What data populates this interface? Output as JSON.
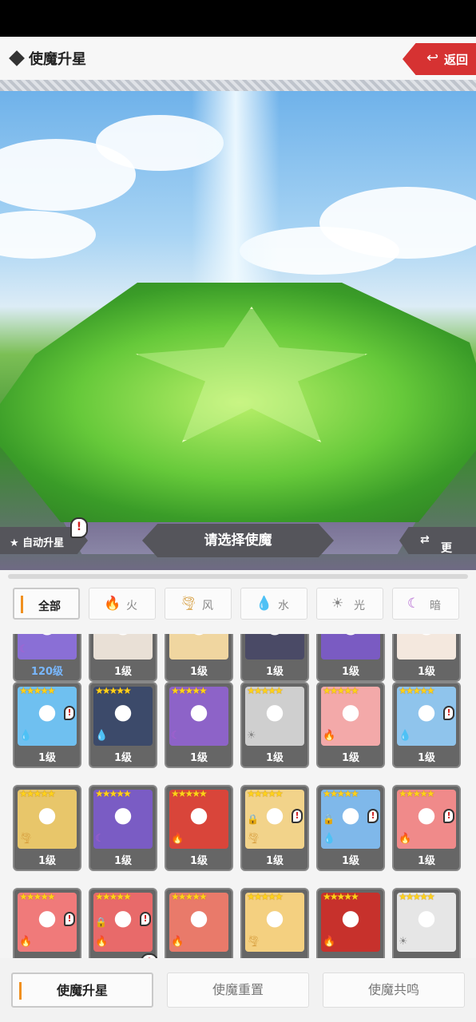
{
  "header": {
    "title": "使魔升星",
    "back_label": "返回",
    "back_icon": "return-arrow"
  },
  "stage": {
    "auto_star_label": "★ 自动升星",
    "select_label": "请选择使魔",
    "swap_label": "更换",
    "swap_icon": "swap-arrows"
  },
  "filters": [
    {
      "label": "全部",
      "icon": "",
      "active": true
    },
    {
      "label": "火",
      "icon": "fire",
      "active": false
    },
    {
      "label": "风",
      "icon": "wind",
      "active": false
    },
    {
      "label": "水",
      "icon": "water",
      "active": false
    },
    {
      "label": "光",
      "icon": "light",
      "active": false
    },
    {
      "label": "暗",
      "icon": "dark",
      "active": false
    }
  ],
  "cards": [
    {
      "level": "120级",
      "stars": "",
      "element": "dark",
      "color": "#8a6fd6",
      "locked": false,
      "alert": false,
      "highlight": true
    },
    {
      "level": "1级",
      "stars": "",
      "element": "",
      "color": "#e9e0d6",
      "locked": false,
      "alert": false
    },
    {
      "level": "1级",
      "stars": "",
      "element": "",
      "color": "#f0d6a0",
      "locked": false,
      "alert": false
    },
    {
      "level": "1级",
      "stars": "",
      "element": "",
      "color": "#4a4a66",
      "locked": false,
      "alert": false
    },
    {
      "level": "1级",
      "stars": "",
      "element": "",
      "color": "#7a5bc2",
      "locked": false,
      "alert": false
    },
    {
      "level": "1级",
      "stars": "",
      "element": "",
      "color": "#f4e8de",
      "locked": false,
      "alert": false
    },
    {
      "level": "1级",
      "stars": "★★★★★",
      "element": "water",
      "color": "#6fc0f0",
      "locked": false,
      "alert": true
    },
    {
      "level": "1级",
      "stars": "★★★★★",
      "element": "water",
      "color": "#3c4a6a",
      "locked": false,
      "alert": false
    },
    {
      "level": "1级",
      "stars": "★★★★★",
      "element": "dark",
      "color": "#8d63c8",
      "locked": false,
      "alert": false
    },
    {
      "level": "1级",
      "stars": "★★★★★",
      "element": "light",
      "color": "#cfcfcf",
      "locked": false,
      "alert": false
    },
    {
      "level": "1级",
      "stars": "★★★★★",
      "element": "fire",
      "color": "#f3a9a9",
      "locked": false,
      "alert": false
    },
    {
      "level": "1级",
      "stars": "★★★★★",
      "element": "water",
      "color": "#8fc4ec",
      "locked": false,
      "alert": true
    },
    {
      "level": "1级",
      "stars": "★★★★★",
      "element": "wind",
      "color": "#e8c66a",
      "locked": false,
      "alert": false
    },
    {
      "level": "1级",
      "stars": "★★★★★",
      "element": "dark",
      "color": "#7a5cc4",
      "locked": false,
      "alert": false
    },
    {
      "level": "1级",
      "stars": "★★★★★",
      "element": "fire",
      "color": "#d9453a",
      "locked": false,
      "alert": false
    },
    {
      "level": "1级",
      "stars": "★★★★★",
      "element": "wind",
      "color": "#f2d38a",
      "locked": true,
      "alert": true
    },
    {
      "level": "1级",
      "stars": "★★★★★",
      "element": "water",
      "color": "#7fb8ea",
      "locked": true,
      "alert": true
    },
    {
      "level": "1级",
      "stars": "★★★★★",
      "element": "fire",
      "color": "#f08a8a",
      "locked": false,
      "alert": true
    },
    {
      "level": "",
      "stars": "★★★★★",
      "element": "fire",
      "color": "#f07a7a",
      "locked": false,
      "alert": true
    },
    {
      "level": "",
      "stars": "★★★★★",
      "element": "fire",
      "color": "#e86a6a",
      "locked": true,
      "alert": true
    },
    {
      "level": "",
      "stars": "★★★★★",
      "element": "fire",
      "color": "#e97a6a",
      "locked": false,
      "alert": false
    },
    {
      "level": "",
      "stars": "★★★★★",
      "element": "wind",
      "color": "#f4d080",
      "locked": false,
      "alert": false
    },
    {
      "level": "",
      "stars": "★★★★★",
      "element": "fire",
      "color": "#c7312c",
      "locked": false,
      "alert": false
    },
    {
      "level": "",
      "stars": "★★★★★",
      "element": "light",
      "color": "#e6e6e6",
      "locked": false,
      "alert": false
    }
  ],
  "bottom": {
    "tabs": [
      "使魔升星",
      "使魔重置",
      "使魔共鸣"
    ],
    "active": 0
  }
}
